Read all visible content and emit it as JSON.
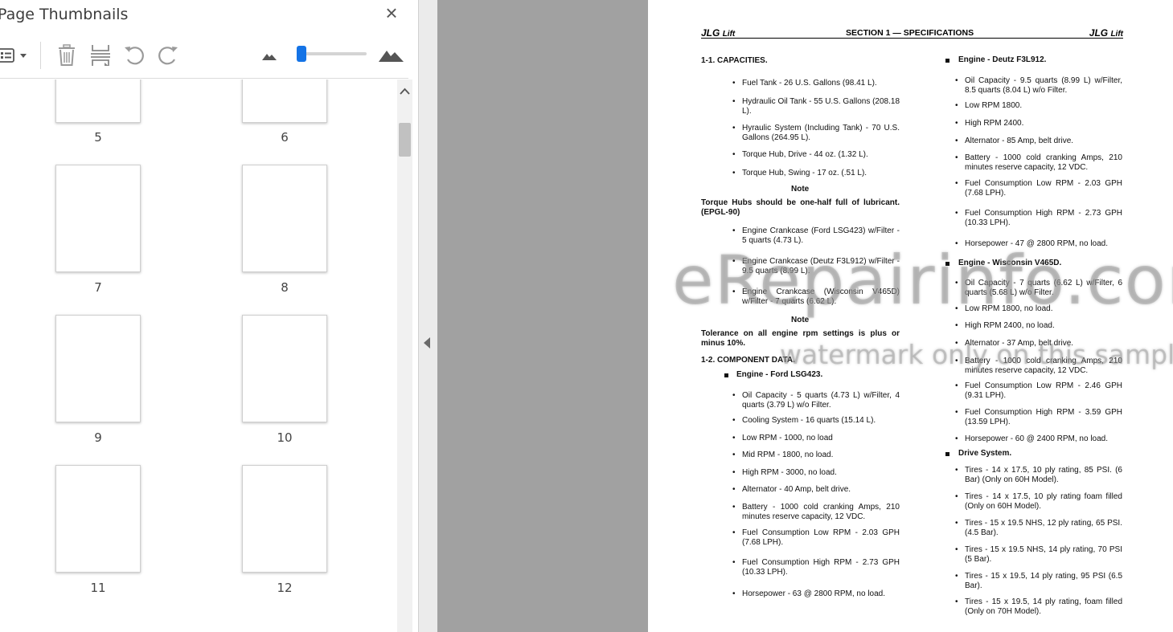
{
  "panel": {
    "title": "Page Thumbnails",
    "close": "×",
    "toolbar": [
      "thumbnail-options-icon",
      "delete-pages-icon",
      "insert-page-icon",
      "rotate-counterclockwise-icon",
      "rotate-clockwise-icon",
      "zoom-out-icon",
      "zoom-in-icon"
    ],
    "zoom_level": 0.05
  },
  "thumbnails": [
    {
      "label": "5"
    },
    {
      "label": "6"
    },
    {
      "label": "7"
    },
    {
      "label": "8"
    },
    {
      "label": "9"
    },
    {
      "label": "10"
    },
    {
      "label": "11"
    },
    {
      "label": "12"
    }
  ],
  "scroll_up": "⌃",
  "page": {
    "header_left": "JLG",
    "header_left_suffix": "Lift",
    "header_title": "SECTION 1 — SPECIFICATIONS",
    "header_right": "JLG",
    "header_right_suffix": "Lift",
    "s1_title": "1-1.   CAPACITIES.",
    "s1_items": [
      "Fuel Tank - 26 U.S. Gallons (98.41 L).",
      "Hydraulic Oil Tank - 55 U.S. Gallons (208.18 L).",
      "Hyraulic System (Including Tank) - 70 U.S. Gallons (264.95 L).",
      "Torque Hub, Drive - 44 oz. (1.32 L).",
      "Torque Hub, Swing - 17 oz. (.51 L)."
    ],
    "note_label": "Note",
    "note1": "Torque Hubs should be one-half full of lubricant. (EPGL-90)",
    "s1_items2": [
      "Engine Crankcase (Ford LSG423) w/Filter - 5 quarts (4.73 L).",
      "Engine Crankcase (Deutz F3L912) w/Filter - 9.5 quarts (8.99 L).",
      "Engine Crankcase (Wisconsin V465D) w/Filter - 7 quarts (6.62 L)."
    ],
    "note2_label": "Note",
    "note2": "Tolerance on all engine rpm settings is plus or minus 10%.",
    "s2_title": "1-2.   COMPONENT DATA.",
    "ford_title": "Engine - Ford LSG423.",
    "ford_items": [
      "Oil Capacity - 5 quarts (4.73 L) w/Filter, 4 quarts (3.79 L) w/o Filter.",
      "Cooling System - 16 quarts (15.14 L).",
      "Low RPM - 1000, no load",
      "Mid RPM - 1800, no load.",
      "High RPM - 3000, no load.",
      "Alternator - 40 Amp, belt drive.",
      "Battery - 1000 cold cranking Amps, 210 minutes reserve capacity, 12 VDC.",
      "Fuel Consumption Low RPM - 2.03 GPH (7.68 LPH).",
      "Fuel Consumption High RPM - 2.73 GPH (10.33 LPH).",
      "Horsepower - 63 @ 2800 RPM, no load."
    ],
    "deutz_title": "Engine - Deutz F3L912.",
    "deutz_items": [
      "Oil Capacity - 9.5 quarts (8.99 L) w/Filter, 8.5 quarts (8.04 L) w/o Filter.",
      "Low RPM 1800.",
      "High RPM 2400.",
      "Alternator - 85 Amp, belt drive.",
      "Battery - 1000 cold cranking Amps, 210 minutes reserve capacity, 12 VDC.",
      "Fuel Consumption Low RPM - 2.03 GPH (7.68 LPH).",
      "Fuel Consumption High RPM - 2.73 GPH (10.33 LPH).",
      "Horsepower - 47 @ 2800 RPM, no load."
    ],
    "wisc_title": "Engine - Wisconsin V465D.",
    "wisc_items": [
      "Oil Capacity - 7 quarts (6.62 L) w/Filter, 6 quarts (5.68 L) w/o Filter.",
      "Low RPM 1800, no load.",
      "High RPM 2400, no load.",
      "Alternator - 37 Amp, belt drive.",
      "Battery - 1000 cold cranking Amps, 210 minutes reserve capacity, 12 VDC.",
      "Fuel Consumption Low RPM - 2.46 GPH (9.31 LPH).",
      "Fuel Consumption High RPM - 3.59 GPH (13.59 LPH).",
      "Horsepower - 60 @ 2400 RPM, no load."
    ],
    "drive_title": "Drive System.",
    "drive_items": [
      "Tires - 14 x 17.5, 10 ply rating, 85 PSI. (6 Bar) (Only on 60H Model).",
      "Tires - 14 x 17.5, 10 ply rating foam filled (Only on 60H Model).",
      "Tires - 15 x 19.5 NHS, 12 ply rating, 65 PSI. (4.5 Bar).",
      "Tires - 15 x 19.5 NHS, 14 ply rating, 70 PSI (5 Bar).",
      "Tires - 15 x 19.5, 14 ply rating, 95 PSI (6.5 Bar).",
      "Tires - 15 x 19.5, 14 ply rating, foam filled (Only on 70H Model)."
    ]
  },
  "watermark": {
    "main": "eRepairinfo.com",
    "sub": "watermark only on this sample"
  }
}
